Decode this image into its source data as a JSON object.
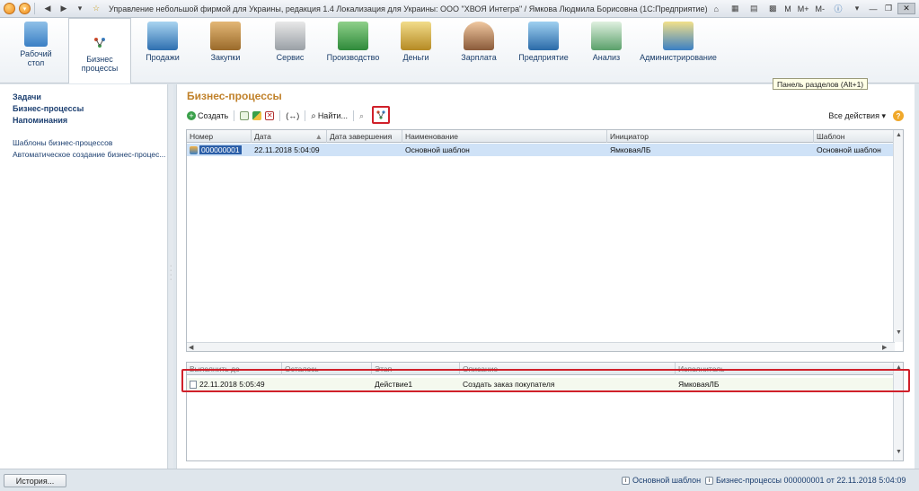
{
  "window": {
    "title": "Управление небольшой фирмой для Украины, редакция 1.4 Локализация для Украины: ООО \"ХВОЯ Интегра\" / Ямкова Людмила Борисовна  (1С:Предприятие)",
    "m_label": "M",
    "m_plus": "M+",
    "m_minus": "M-"
  },
  "sections": [
    {
      "label": "Рабочий стол",
      "icon": "desktop-icon"
    },
    {
      "label": "Бизнес процессы",
      "icon": "business-processes-icon"
    },
    {
      "label": "Продажи",
      "icon": "sales-icon"
    },
    {
      "label": "Закупки",
      "icon": "purchases-icon"
    },
    {
      "label": "Сервис",
      "icon": "service-icon"
    },
    {
      "label": "Производство",
      "icon": "production-icon"
    },
    {
      "label": "Деньги",
      "icon": "money-icon"
    },
    {
      "label": "Зарплата",
      "icon": "salary-icon"
    },
    {
      "label": "Предприятие",
      "icon": "enterprise-icon"
    },
    {
      "label": "Анализ",
      "icon": "analysis-icon"
    },
    {
      "label": "Администрирование",
      "icon": "administration-icon"
    }
  ],
  "tooltip": "Панель разделов (Alt+1)",
  "leftnav": {
    "strong_items": [
      "Задачи",
      "Бизнес-процессы",
      "Напоминания"
    ],
    "links": [
      "Шаблоны бизнес-процессов",
      "Автоматическое создание бизнес-процес..."
    ]
  },
  "main": {
    "title": "Бизнес-процессы",
    "toolbar": {
      "create": "Создать",
      "find": "Найти...",
      "all_actions": "Все действия",
      "help": "?"
    },
    "top_table": {
      "columns": [
        "Номер",
        "Дата",
        "Дата завершения",
        "Наименование",
        "Инициатор",
        "Шаблон"
      ],
      "rows": [
        {
          "number": "000000001",
          "date": "22.11.2018 5:04:09",
          "end_date": "",
          "name": "Основной шаблон",
          "initiator": "ЯмковаяЛБ",
          "template": "Основной шаблон"
        }
      ]
    },
    "bottom_table": {
      "columns": [
        "Выполнить до",
        "Осталось",
        "Этап",
        "Описание",
        "Исполнитель"
      ],
      "rows": [
        {
          "due": "22.11.2018 5:05:49",
          "left": "",
          "stage": "Действие1",
          "description": "Создать заказ покупателя",
          "executor": "ЯмковаяЛБ"
        }
      ]
    }
  },
  "statusbar": {
    "history": "История...",
    "item1": "Основной шаблон",
    "item2": "Бизнес-процессы 000000001 от 22.11.2018 5:04:09"
  },
  "colors": {
    "title_accent": "#c0812a",
    "link": "#1c3f70",
    "highlight": "#d0202a",
    "selected_row": "#cfe2f7"
  }
}
